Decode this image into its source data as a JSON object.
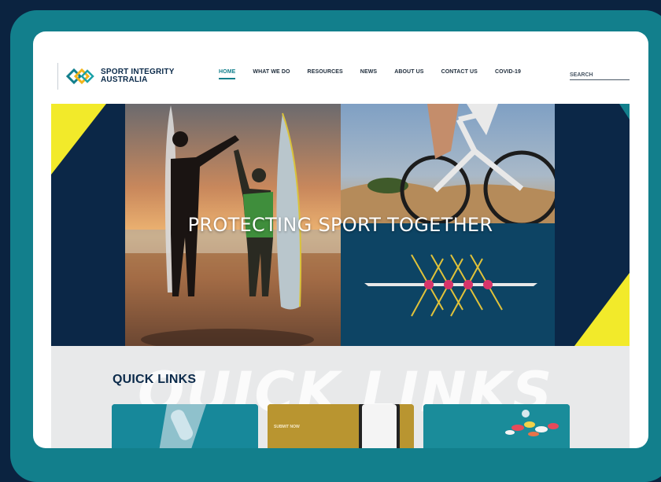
{
  "site": {
    "logo_line1": "SPORT INTEGRITY",
    "logo_line2": "AUSTRALIA"
  },
  "nav": {
    "items": [
      {
        "label": "HOME",
        "active": true
      },
      {
        "label": "WHAT WE DO"
      },
      {
        "label": "RESOURCES"
      },
      {
        "label": "NEWS"
      },
      {
        "label": "ABOUT US"
      },
      {
        "label": "CONTACT US"
      },
      {
        "label": "COVID-19"
      }
    ]
  },
  "search": {
    "placeholder": "SEARCH"
  },
  "hero": {
    "title": "PROTECTING SPORT TOGETHER"
  },
  "quick_links": {
    "title": "QUICK LINKS",
    "watermark": "QUICK LINKS",
    "cards": [
      {
        "label": ""
      },
      {
        "label": "SUBMIT NOW"
      },
      {
        "label": ""
      }
    ]
  },
  "colors": {
    "device_frame": "#127f8c",
    "background": "#0b2340",
    "navy": "#0b2747",
    "accent_yellow": "#f2ea2a",
    "teal": "#127f8c"
  }
}
